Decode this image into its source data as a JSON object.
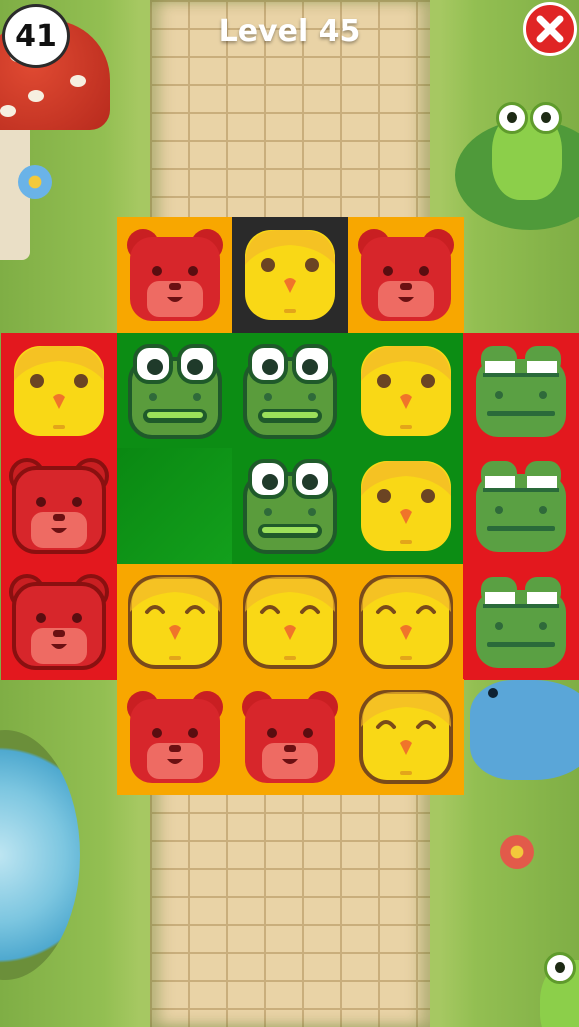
{
  "hud": {
    "moves_left": "41",
    "level_title": "Level 45"
  },
  "colors": {
    "orange": "#f8a700",
    "red": "#e3181e",
    "green": "#0c8d14",
    "dark": "#2a2a2a",
    "close_button": "#e02525"
  },
  "board": {
    "rows": 6,
    "cols": 5,
    "cells": [
      {
        "row": 0,
        "col": 1,
        "bg": "orange",
        "piece": "bear"
      },
      {
        "row": 0,
        "col": 2,
        "bg": "dark",
        "piece": "chick"
      },
      {
        "row": 0,
        "col": 3,
        "bg": "orange",
        "piece": "bear"
      },
      {
        "row": 1,
        "col": 0,
        "bg": "red",
        "piece": "chick"
      },
      {
        "row": 1,
        "col": 1,
        "bg": "green",
        "piece": "frog"
      },
      {
        "row": 1,
        "col": 2,
        "bg": "green",
        "piece": "frog"
      },
      {
        "row": 1,
        "col": 3,
        "bg": "green",
        "piece": "chick"
      },
      {
        "row": 1,
        "col": 4,
        "bg": "red",
        "piece": "frog-sleep"
      },
      {
        "row": 2,
        "col": 0,
        "bg": "red",
        "piece": "bear-outline"
      },
      {
        "row": 2,
        "col": 1,
        "bg": "green",
        "piece": "empty"
      },
      {
        "row": 2,
        "col": 2,
        "bg": "green",
        "piece": "frog"
      },
      {
        "row": 2,
        "col": 3,
        "bg": "green",
        "piece": "chick"
      },
      {
        "row": 2,
        "col": 4,
        "bg": "red",
        "piece": "frog-sleep"
      },
      {
        "row": 3,
        "col": 0,
        "bg": "red",
        "piece": "bear-outline"
      },
      {
        "row": 3,
        "col": 1,
        "bg": "orange",
        "piece": "chick-happy"
      },
      {
        "row": 3,
        "col": 2,
        "bg": "orange",
        "piece": "chick-happy"
      },
      {
        "row": 3,
        "col": 3,
        "bg": "orange",
        "piece": "chick-happy"
      },
      {
        "row": 3,
        "col": 4,
        "bg": "red",
        "piece": "frog-sleep"
      },
      {
        "row": 4,
        "col": 1,
        "bg": "orange",
        "piece": "bear"
      },
      {
        "row": 4,
        "col": 2,
        "bg": "orange",
        "piece": "bear"
      },
      {
        "row": 4,
        "col": 3,
        "bg": "orange",
        "piece": "chick-happy"
      }
    ]
  },
  "icons": {
    "close": "close-icon"
  }
}
